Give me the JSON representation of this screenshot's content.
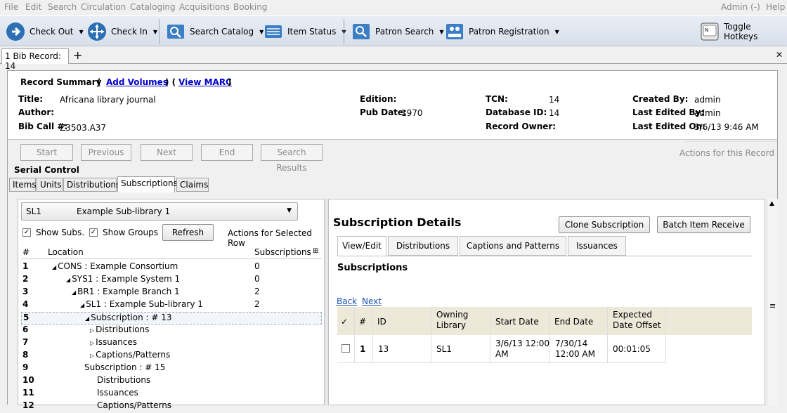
{
  "menu": [
    "File",
    "Edit",
    "Search",
    "Circulation",
    "Cataloging",
    "Acquisitions",
    "Booking"
  ],
  "menu_right": {
    "admin": "Admin (-)",
    "help": "Help"
  },
  "toolbar": {
    "check_out": "Check Out",
    "check_in": "Check In",
    "search_catalog": "Search Catalog",
    "item_status": "Item Status",
    "patron_search": "Patron Search",
    "patron_registration": "Patron Registration",
    "toggle_hotkeys": "Toggle Hotkeys"
  },
  "tab": {
    "label": "1 Bib Record: 14"
  },
  "summary": {
    "heading": "Record Summary",
    "paren_open": "(",
    "add_volumes": "Add Volumes",
    "paren_mid": ") (",
    "view_marc": "View MARC",
    "paren_close": ")",
    "title_label": "Title:",
    "title_value": "Africana library journal",
    "author_label": "Author:",
    "callno_label": "Bib Call #:",
    "callno_value": "Z3503.A37",
    "edition_label": "Edition:",
    "pubdate_label": "Pub Date:",
    "pubdate_value": "1970",
    "tcn_label": "TCN:",
    "tcn_value": "14",
    "dbid_label": "Database ID:",
    "dbid_value": "14",
    "owner_label": "Record Owner:",
    "created_label": "Created By:",
    "created_value": "admin",
    "edited_label": "Last Edited By:",
    "edited_value": "admin",
    "editedon_label": "Last Edited On:",
    "editedon_value": "3/6/13 9:46 AM"
  },
  "nav": {
    "start": "Start",
    "previous": "Previous",
    "next": "Next",
    "end": "End",
    "search_results": "Search Results",
    "actions": "Actions for this Record"
  },
  "serial_control": "Serial Control",
  "serial_tabs": [
    "Items",
    "Units",
    "Distributions",
    "Subscriptions",
    "Claims"
  ],
  "left": {
    "lib_code": "SL1",
    "lib_name": "Example Sub-library 1",
    "show_subs": "Show Subs.",
    "show_groups": "Show Groups",
    "refresh": "Refresh",
    "actions_selected": "Actions for Selected Row",
    "col_num": "#",
    "col_location": "Location",
    "col_subscriptions": "Subscriptions",
    "rows": [
      {
        "num": "1",
        "loc": "CONS : Example Consortium",
        "cnt": "0"
      },
      {
        "num": "2",
        "loc": "SYS1 : Example System 1",
        "cnt": "0"
      },
      {
        "num": "3",
        "loc": "BR1 : Example Branch 1",
        "cnt": "2"
      },
      {
        "num": "4",
        "loc": "SL1 : Example Sub-library 1",
        "cnt": "2"
      },
      {
        "num": "5",
        "loc": "Subscription : # 13",
        "cnt": ""
      },
      {
        "num": "6",
        "loc": "Distributions",
        "cnt": ""
      },
      {
        "num": "7",
        "loc": "Issuances",
        "cnt": ""
      },
      {
        "num": "8",
        "loc": "Captions/Patterns",
        "cnt": ""
      },
      {
        "num": "9",
        "loc": "Subscription : # 15",
        "cnt": ""
      },
      {
        "num": "10",
        "loc": "Distributions",
        "cnt": ""
      },
      {
        "num": "11",
        "loc": "Issuances",
        "cnt": ""
      },
      {
        "num": "12",
        "loc": "Captions/Patterns",
        "cnt": ""
      }
    ]
  },
  "right": {
    "title": "Subscription Details",
    "clone": "Clone Subscription",
    "batch": "Batch Item Receive",
    "tabs": [
      "View/Edit",
      "Distributions",
      "Captions and Patterns",
      "Issuances"
    ],
    "section": "Subscriptions",
    "back": "Back",
    "next": "Next",
    "headers": {
      "check": "✓",
      "num": "#",
      "id": "ID",
      "owning": "Owning Library",
      "start": "Start Date",
      "end": "End Date",
      "offset": "Expected Date Offset"
    },
    "row": {
      "num": "1",
      "id": "13",
      "owning": "SL1",
      "start": "3/6/13 12:00 AM",
      "end": "7/30/14 12:00 AM",
      "offset": "00:01:05"
    }
  }
}
